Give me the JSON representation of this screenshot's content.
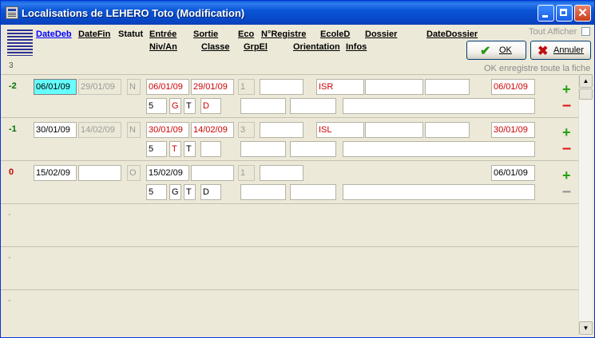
{
  "window": {
    "title": "Localisations de LEHERO Toto (Modification)"
  },
  "header": {
    "count": "3",
    "tout_afficher": "Tout Afficher",
    "ok_label": "OK",
    "annuler_label": "Annuler",
    "hint": "OK enregistre toute la fiche",
    "cols": {
      "datedeb": "DateDeb",
      "datefin": "DateFin",
      "statut": "Statut",
      "entree": "Entrée",
      "nivan": "Niv/An",
      "sortie": "Sortie",
      "classe": "Classe",
      "eco": "Eco",
      "grpel": "GrpEl",
      "nregistre": "N°Registre",
      "orientation": "Orientation",
      "ecoled": "EcoleD",
      "infos": "Infos",
      "dossier": "Dossier",
      "datedossier": "DateDossier"
    }
  },
  "rows": [
    {
      "label": "-2",
      "datedeb": "06/01/09",
      "datefin": "29/01/09",
      "statut": "N",
      "entree": "06/01/09",
      "sortie": "29/01/09",
      "eco": "1",
      "nregistre": "",
      "ecoled": "ISR",
      "dossier": "",
      "f_extra": "",
      "datedossier": "06/01/09",
      "niv": "5",
      "grp": "G",
      "tgrp": "T",
      "classe": "D",
      "f_a": "",
      "f_b": "",
      "infos": ""
    },
    {
      "label": "-1",
      "datedeb": "30/01/09",
      "datefin": "14/02/09",
      "statut": "N",
      "entree": "30/01/09",
      "sortie": "14/02/09",
      "eco": "3",
      "nregistre": "",
      "ecoled": "ISL",
      "dossier": "",
      "f_extra": "",
      "datedossier": "30/01/09",
      "niv": "5",
      "grp": "T",
      "tgrp": "T",
      "classe": "",
      "f_a": "",
      "f_b": "",
      "infos": ""
    },
    {
      "label": "0",
      "datedeb": "15/02/09",
      "datefin": "",
      "statut": "O",
      "entree": "15/02/09",
      "sortie": "",
      "eco": "1",
      "nregistre": "",
      "datedossier": "06/01/09",
      "niv": "5",
      "grp": "G",
      "tgrp": "T",
      "classe": "D",
      "f_a": "",
      "f_b": "",
      "infos": ""
    }
  ],
  "empty_rows": [
    "-",
    "-",
    "-"
  ],
  "colors": {
    "label_green": "#007000",
    "label_red": "#cc0000",
    "selected_field": "#66ffff"
  }
}
